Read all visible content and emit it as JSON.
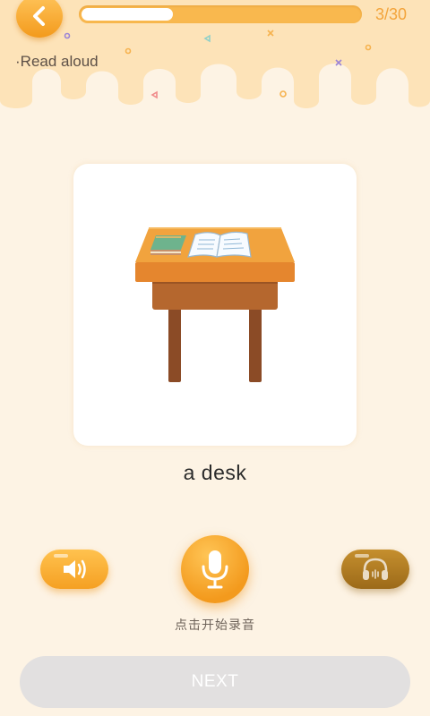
{
  "header": {
    "back_icon": "chevron-left-icon",
    "progress_fraction": 0.33,
    "progress_count": "3/30",
    "mode_label": "·Read aloud"
  },
  "card": {
    "word": "a desk",
    "image": "desk-with-books-illustration"
  },
  "controls": {
    "speaker_icon": "speaker-icon",
    "mic_icon": "microphone-icon",
    "headphones_icon": "headphones-icon",
    "mic_hint": "点击开始录音"
  },
  "footer": {
    "next_label": "NEXT"
  },
  "colors": {
    "accent": "#f5a023",
    "header_cream": "#fde3b8",
    "background": "#fdf3e4",
    "disabled_button": "#e2e0e0"
  }
}
